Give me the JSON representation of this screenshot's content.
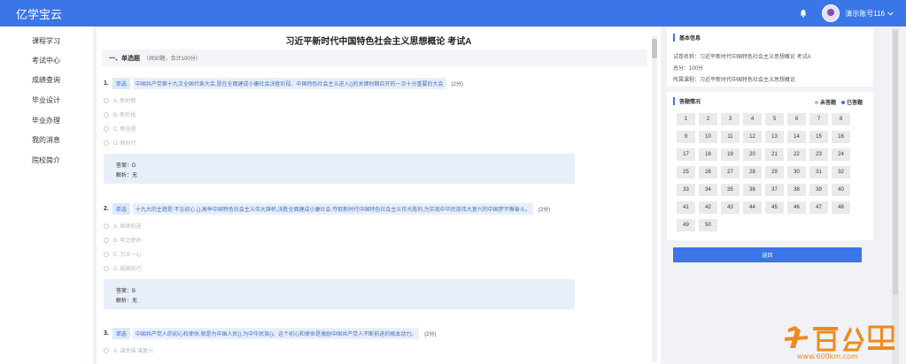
{
  "header": {
    "brand": "亿学宝云",
    "user_name": "演示账号116",
    "bell_icon": "bell-icon",
    "dropdown_icon": "chevron-down-icon"
  },
  "sidebar": {
    "items": [
      "课程学习",
      "考试中心",
      "成绩查询",
      "毕业设计",
      "毕业办理",
      "我的消息",
      "院校简介"
    ]
  },
  "exam": {
    "title": "习近平新时代中国特色社会主义思想概论 考试A",
    "section": {
      "name": "一、单选题",
      "meta": "（共50题，合计100分）"
    },
    "answer_label": "答案：",
    "analysis_label": "解析：",
    "questions": [
      {
        "num": "1.",
        "type": "单选",
        "text": "中国共产党第十九次全国代表大会,是在全面建成小康社会决胜阶段、中国特色社会主义进入()的关键时期召开的一次十分重要的大会",
        "score": "(2分)",
        "options": [
          "A. 新时期",
          "B. 新阶段",
          "C. 新征程",
          "D. 新时代"
        ],
        "answer": "D",
        "analysis": "无"
      },
      {
        "num": "2.",
        "type": "单选",
        "text": "十九大的主题是:不忘初心,(),高举中国特色社会主义伟大旗帜,决胜全面建成小康社会,夺取新时代中国特色社会主义伟大胜利,为实现中华民族伟大复兴的中国梦不懈奋斗。",
        "score": "(2分)",
        "options": [
          "A. 继续前进",
          "B. 牢记使命",
          "C. 万众一心",
          "D. 砥砺前行"
        ],
        "answer": "B",
        "analysis": "无"
      },
      {
        "num": "3.",
        "type": "单选",
        "text": "中国共产党人的初心和使命,就是为中国人民(),为中华民族()。这个初心和使命是激励中国共产党人不断前进的根本动力。",
        "score": "(2分)",
        "options": [
          "A. 谋幸福 谋复兴"
        ]
      }
    ]
  },
  "info_panel": {
    "title": "基本信息",
    "paper_name": "试卷名称：习近平新时代中国特色社会主义思想概论 考试A",
    "total": "总分：100分",
    "course": "所属课程：习近平新时代中国特色社会主义思想概论"
  },
  "answer_panel": {
    "title": "答题情况",
    "legend_unanswered": "未答题",
    "legend_answered": "已答题",
    "numbers": [
      "1",
      "2",
      "3",
      "4",
      "5",
      "6",
      "7",
      "8",
      "9",
      "10",
      "11",
      "12",
      "13",
      "14",
      "15",
      "16",
      "17",
      "18",
      "19",
      "20",
      "21",
      "22",
      "23",
      "24",
      "25",
      "26",
      "27",
      "28",
      "29",
      "30",
      "31",
      "32",
      "33",
      "34",
      "35",
      "36",
      "37",
      "38",
      "39",
      "40",
      "41",
      "42",
      "43",
      "44",
      "45",
      "46",
      "47",
      "48",
      "49",
      "50"
    ]
  },
  "actions": {
    "return_label": "返回"
  },
  "watermark": {
    "logo": "百公里",
    "url": "www.600km.com"
  },
  "colors": {
    "primary": "#3a76e8",
    "watermark": "#f08a1c"
  }
}
